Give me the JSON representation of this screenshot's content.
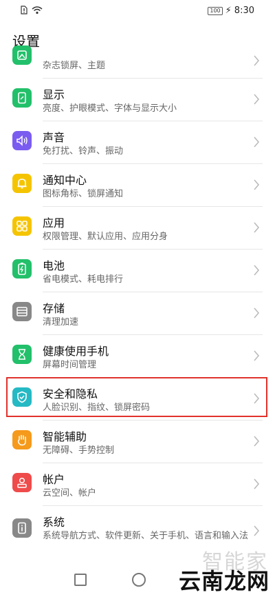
{
  "status": {
    "time": "8:30",
    "battery": "100"
  },
  "page": {
    "title": "设置"
  },
  "items": [
    {
      "title": "",
      "subtitle": "杂志锁屏、主题",
      "color": "#22c06a",
      "icon": "wallpaper-icon"
    },
    {
      "title": "显示",
      "subtitle": "亮度、护眼模式、字体与显示大小",
      "color": "#22c06a",
      "icon": "display-icon"
    },
    {
      "title": "声音",
      "subtitle": "免打扰、铃声、振动",
      "color": "#7b5cf0",
      "icon": "sound-icon"
    },
    {
      "title": "通知中心",
      "subtitle": "图标角标、锁屏通知",
      "color": "#f5c400",
      "icon": "notification-icon"
    },
    {
      "title": "应用",
      "subtitle": "权限管理、默认应用、应用分身",
      "color": "#f5c400",
      "icon": "apps-icon"
    },
    {
      "title": "电池",
      "subtitle": "省电模式、耗电排行",
      "color": "#22c06a",
      "icon": "battery-icon"
    },
    {
      "title": "存储",
      "subtitle": "清理加速",
      "color": "#888888",
      "icon": "storage-icon"
    },
    {
      "title": "健康使用手机",
      "subtitle": "屏幕时间管理",
      "color": "#22c06a",
      "icon": "hourglass-icon"
    },
    {
      "title": "安全和隐私",
      "subtitle": "人脸识别、指纹、锁屏密码",
      "color": "#25b9c4",
      "icon": "shield-icon"
    },
    {
      "title": "智能辅助",
      "subtitle": "无障碍、手势控制",
      "color": "#f59a1b",
      "icon": "hand-icon"
    },
    {
      "title": "帐户",
      "subtitle": "云空间、帐户",
      "color": "#ef4b4b",
      "icon": "account-icon"
    },
    {
      "title": "系统",
      "subtitle": "系统导航方式、软件更新、关于手机、语言和输入法",
      "color": "#888888",
      "icon": "system-info-icon"
    }
  ],
  "watermark": {
    "top": "智能家",
    "bottom": "云南龙网"
  }
}
